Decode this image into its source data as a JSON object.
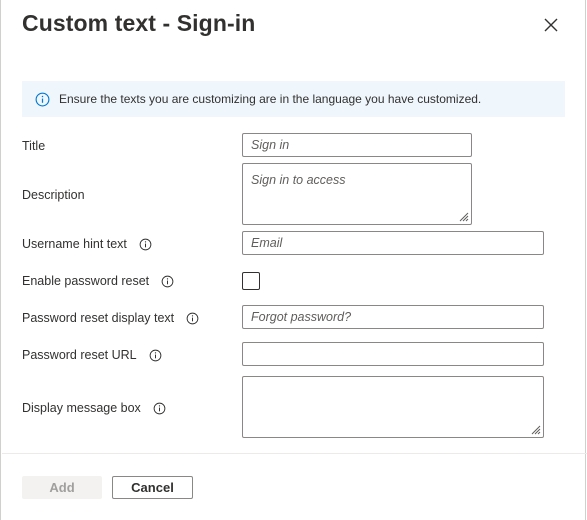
{
  "dialog": {
    "title": "Custom text - Sign-in",
    "close_icon": "close-icon"
  },
  "info_bar": {
    "icon": "info-icon",
    "text": "Ensure the texts you are customizing are in the language you have customized."
  },
  "fields": {
    "title": {
      "label": "Title",
      "placeholder": "Sign in",
      "value": ""
    },
    "description": {
      "label": "Description",
      "placeholder": "Sign in to access",
      "value": ""
    },
    "username_hint": {
      "label": "Username hint text",
      "placeholder": "Email",
      "value": ""
    },
    "enable_password_reset": {
      "label": "Enable password reset",
      "checked": false
    },
    "password_reset_text": {
      "label": "Password reset display text",
      "placeholder": "Forgot password?",
      "value": ""
    },
    "password_reset_url": {
      "label": "Password reset URL",
      "placeholder": "",
      "value": ""
    },
    "display_message": {
      "label": "Display message box",
      "placeholder": "",
      "value": ""
    }
  },
  "footer": {
    "add_label": "Add",
    "cancel_label": "Cancel"
  },
  "colors": {
    "info_background": "#eff6fc",
    "info_icon": "#0078d4",
    "border": "#8a8886",
    "disabled_button": "#f3f2f1"
  }
}
